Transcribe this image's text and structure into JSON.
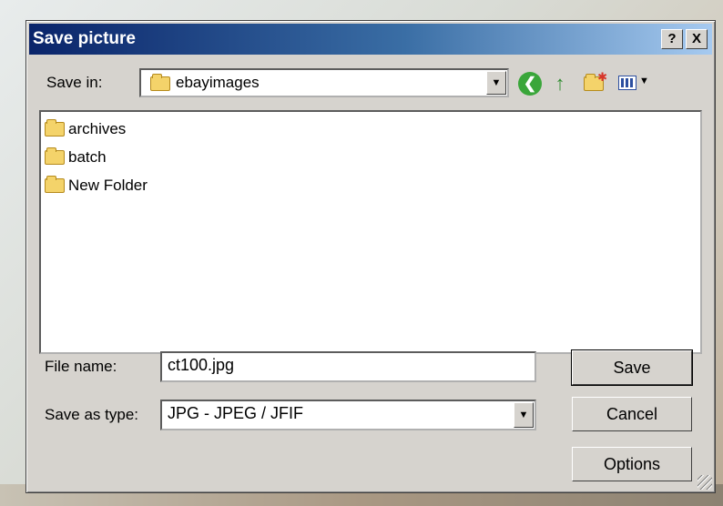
{
  "dialog": {
    "title": "Save picture",
    "help_label": "?",
    "close_label": "X"
  },
  "save_in": {
    "label": "Save in:",
    "value": "ebayimages"
  },
  "toolbar": {
    "icons": [
      "back-icon",
      "up-folder-icon",
      "new-folder-icon",
      "views-menu-icon"
    ],
    "back_glyph": "❮",
    "up_glyph": "↑"
  },
  "files": [
    {
      "name": "archives",
      "icon": "folder-icon"
    },
    {
      "name": "batch",
      "icon": "folder-icon"
    },
    {
      "name": "New Folder",
      "icon": "folder-icon"
    }
  ],
  "file_name": {
    "label": "File name:",
    "value": "ct100.jpg"
  },
  "save_as_type": {
    "label": "Save as type:",
    "value": "JPG - JPEG / JFIF"
  },
  "buttons": {
    "save": "Save",
    "cancel": "Cancel",
    "options": "Options"
  },
  "colors": {
    "titlebar_start": "#0a246a",
    "titlebar_end": "#a6caf0",
    "dialog_face": "#d6d3ce",
    "folder_yellow": "#f4d36a"
  }
}
